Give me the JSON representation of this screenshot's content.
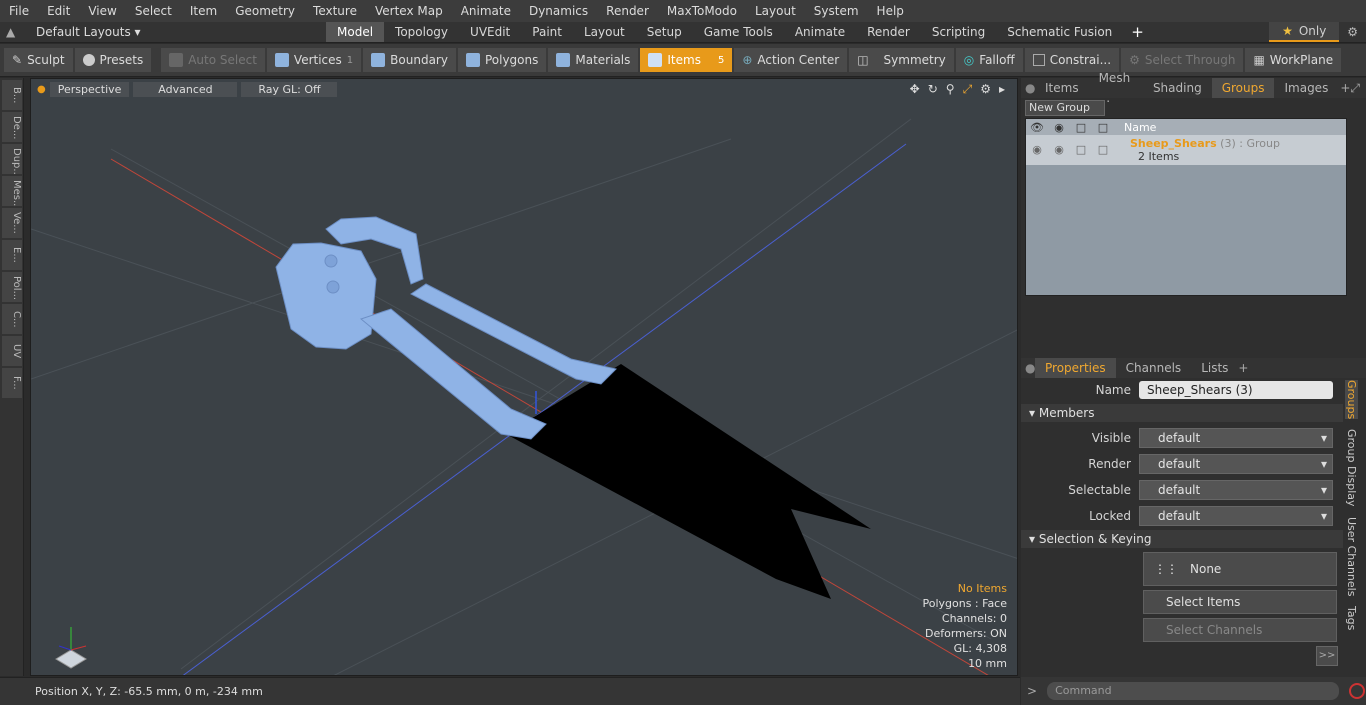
{
  "menu": {
    "items": [
      "File",
      "Edit",
      "View",
      "Select",
      "Item",
      "Geometry",
      "Texture",
      "Vertex Map",
      "Animate",
      "Dynamics",
      "Render",
      "MaxToModo",
      "Layout",
      "System",
      "Help"
    ]
  },
  "layout": {
    "selector": "Default Layouts",
    "tabs": [
      "Model",
      "Topology",
      "UVEdit",
      "Paint",
      "Layout",
      "Setup",
      "Game Tools",
      "Animate",
      "Render",
      "Scripting",
      "Schematic Fusion"
    ],
    "active": "Model",
    "only_label": "Only"
  },
  "toolbar": {
    "sculpt": "Sculpt",
    "presets": "Presets",
    "auto_select": "Auto Select",
    "vertices": "Vertices",
    "vertices_count": "1",
    "boundary": "Boundary",
    "polygons": "Polygons",
    "materials": "Materials",
    "items": "Items",
    "items_count": "5",
    "action_center": "Action Center",
    "symmetry": "Symmetry",
    "falloff": "Falloff",
    "constrain": "Constrai...",
    "select_through": "Select Through",
    "workplane": "WorkPlane"
  },
  "left_strip": [
    "B...",
    "De...",
    "Dup...",
    "Mes...",
    "Ve...",
    "E...",
    "Pol...",
    "C...",
    "UV",
    "F..."
  ],
  "viewport": {
    "perspective": "Perspective",
    "advanced": "Advanced",
    "raygl": "Ray GL: Off",
    "stats": {
      "no_items": "No Items",
      "polygons": "Polygons : Face",
      "channels": "Channels: 0",
      "deformers": "Deformers: ON",
      "gl": "GL: 4,308",
      "scale": "10 mm"
    }
  },
  "status": {
    "position": "Position X, Y, Z:   -65.5 mm, 0 m, -234 mm"
  },
  "groups_panel": {
    "tabs": [
      "Items",
      "Mesh ...",
      "Shading",
      "Groups",
      "Images"
    ],
    "active": "Groups",
    "new_group": "New Group",
    "col_name": "Name",
    "group_name": "Sheep_Shears",
    "group_count": "(3)",
    "group_type": ": Group",
    "group_items": "2 Items"
  },
  "properties": {
    "tabs": [
      "Properties",
      "Channels",
      "Lists"
    ],
    "active": "Properties",
    "name_label": "Name",
    "name_value": "Sheep_Shears (3)",
    "members": "Members",
    "visible_label": "Visible",
    "visible": "default",
    "render_label": "Render",
    "render": "default",
    "selectable_label": "Selectable",
    "selectable": "default",
    "locked_label": "Locked",
    "locked": "default",
    "sel_keying": "Selection & Keying",
    "none": "None",
    "select_items": "Select Items",
    "select_channels": "Select Channels",
    "expand": ">>",
    "side_tabs": [
      "Groups",
      "Group Display",
      "User Channels",
      "Tags"
    ]
  },
  "command": {
    "placeholder": "Command"
  },
  "colors": {
    "accent": "#e89a1a",
    "mesh": "#8fb3e6",
    "viewport_bg": "#3b4146"
  }
}
